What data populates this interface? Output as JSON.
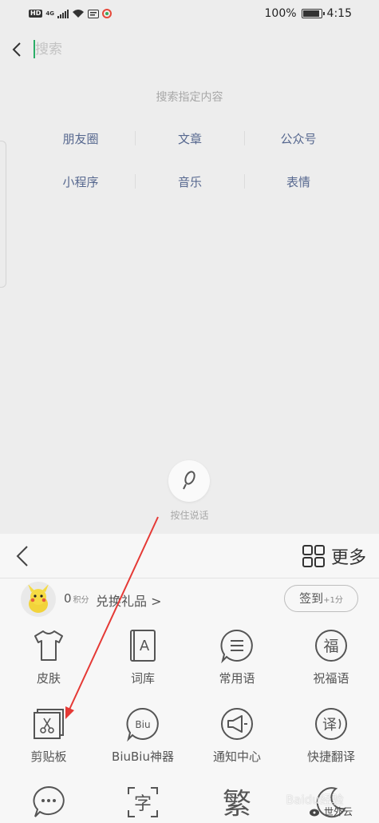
{
  "status_bar": {
    "left_badge": "HD",
    "network": "4G",
    "battery": "100%",
    "time": "4:15"
  },
  "search": {
    "placeholder": "搜索",
    "value": ""
  },
  "search_hint": "搜索指定内容",
  "categories": [
    "朋友圈",
    "文章",
    "公众号",
    "小程序",
    "音乐",
    "表情"
  ],
  "voice": {
    "label": "按住说话"
  },
  "keyboard": {
    "more_label": "更多",
    "points_value": "0",
    "points_unit": "积分",
    "exchange_label": "兑换礼品 >",
    "signin_label": "签到",
    "signin_bonus": "+1分",
    "tools": [
      {
        "label": "皮肤",
        "icon": "tshirt-icon"
      },
      {
        "label": "词库",
        "icon": "dictionary-icon"
      },
      {
        "label": "常用语",
        "icon": "phrases-icon"
      },
      {
        "label": "祝福语",
        "icon": "blessing-icon",
        "glyph": "福"
      },
      {
        "label": "剪贴板",
        "icon": "clipboard-icon"
      },
      {
        "label": "BiuBiu神器",
        "icon": "biubiu-icon",
        "glyph": "Biu"
      },
      {
        "label": "通知中心",
        "icon": "megaphone-icon"
      },
      {
        "label": "快捷翻译",
        "icon": "translate-icon",
        "glyph": "译"
      },
      {
        "label": "",
        "icon": "chat-bubble-icon"
      },
      {
        "label": "",
        "icon": "text-scan-icon",
        "glyph": "字"
      },
      {
        "label": "",
        "icon": "traditional-chinese-icon",
        "glyph": "繁"
      },
      {
        "label": "",
        "icon": "moon-icon"
      }
    ]
  },
  "watermark": {
    "brand": "Baidu经验",
    "account": "世外云"
  },
  "colors": {
    "accent": "#2aae67",
    "link": "#57688f",
    "annotation_arrow": "#e53935"
  }
}
